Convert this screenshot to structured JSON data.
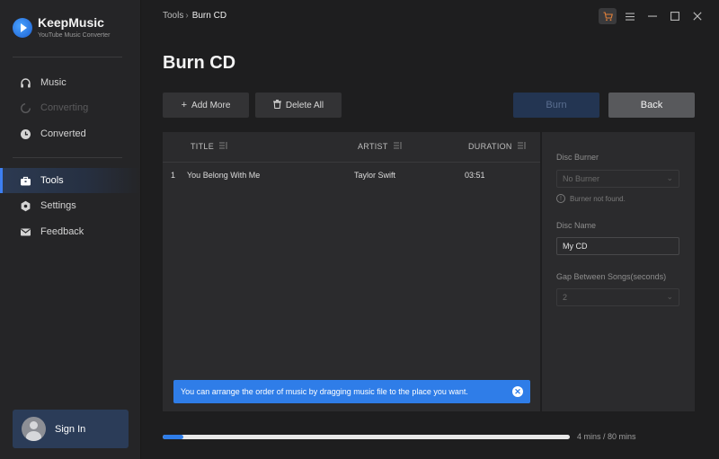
{
  "app": {
    "name": "KeepMusic",
    "subtitle": "YouTube Music Converter"
  },
  "sidebar": {
    "items": [
      {
        "label": "Music",
        "icon": "headphones-icon",
        "state": "normal"
      },
      {
        "label": "Converting",
        "icon": "spinner-icon",
        "state": "disabled"
      },
      {
        "label": "Converted",
        "icon": "clock-icon",
        "state": "normal"
      },
      {
        "label": "Tools",
        "icon": "toolbox-icon",
        "state": "active"
      },
      {
        "label": "Settings",
        "icon": "gear-icon",
        "state": "normal"
      },
      {
        "label": "Feedback",
        "icon": "mail-icon",
        "state": "normal"
      }
    ],
    "signin_label": "Sign In"
  },
  "breadcrumb": {
    "parent": "Tools",
    "separator": "›",
    "current": "Burn CD"
  },
  "page": {
    "title": "Burn CD"
  },
  "toolbar": {
    "add_more_label": "Add More",
    "delete_all_label": "Delete All",
    "burn_label": "Burn",
    "back_label": "Back"
  },
  "table": {
    "columns": [
      "TITLE",
      "ARTIST",
      "DURATION"
    ],
    "rows": [
      {
        "index": "1",
        "title": "You Belong With Me",
        "artist": "Taylor Swift",
        "duration": "03:51"
      }
    ]
  },
  "hint": {
    "text": "You can arrange the order of music by dragging music file to the place you want."
  },
  "settings": {
    "disc_burner_label": "Disc Burner",
    "disc_burner_value": "No Burner",
    "burner_note": "Burner not found.",
    "disc_name_label": "Disc Name",
    "disc_name_value": "My CD",
    "gap_label": "Gap Between Songs(seconds)",
    "gap_value": "2"
  },
  "progress": {
    "text": "4 mins / 80 mins",
    "fraction": 0.05
  },
  "colors": {
    "accent": "#2f7de8",
    "background": "#1e1e1f",
    "panel": "#2b2b2d"
  }
}
